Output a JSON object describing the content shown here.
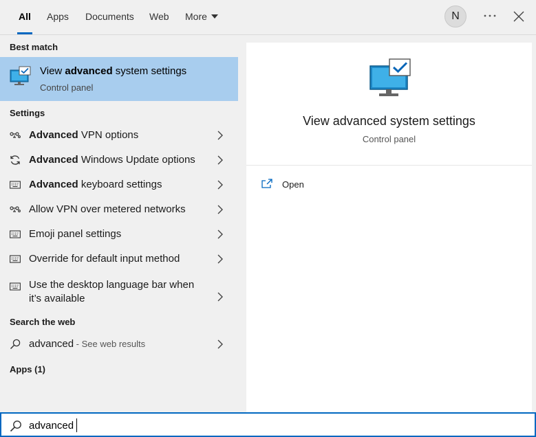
{
  "tabs": [
    {
      "label": "All"
    },
    {
      "label": "Apps"
    },
    {
      "label": "Documents"
    },
    {
      "label": "Web"
    },
    {
      "label": "More"
    }
  ],
  "user": {
    "initial": "N"
  },
  "sections": {
    "best_match": "Best match",
    "settings": "Settings",
    "search_web": "Search the web",
    "apps": "Apps (1)"
  },
  "best_match": {
    "title_pre": "View ",
    "title_bold": "advanced",
    "title_post": " system settings",
    "subtitle": "Control panel",
    "icon": "monitor-check-icon"
  },
  "settings_items": [
    {
      "bold": "Advanced",
      "rest": " VPN options",
      "icon": "vpn-icon"
    },
    {
      "bold": "Advanced",
      "rest": " Windows Update options",
      "icon": "sync-icon"
    },
    {
      "bold": "Advanced",
      "rest": " keyboard settings",
      "icon": "keyboard-icon"
    },
    {
      "bold": "",
      "rest": "Allow VPN over metered networks",
      "icon": "vpn-icon"
    },
    {
      "bold": "",
      "rest": "Emoji panel settings",
      "icon": "keyboard-icon"
    },
    {
      "bold": "",
      "rest": "Override for default input method",
      "icon": "keyboard-icon"
    },
    {
      "bold": "",
      "rest": "Use the desktop language bar when it’s available",
      "icon": "keyboard-icon"
    }
  ],
  "web_result": {
    "query": "advanced",
    "hint": " - See web results",
    "icon": "search-icon"
  },
  "preview": {
    "title": "View advanced system settings",
    "subtitle": "Control panel",
    "actions": [
      {
        "label": "Open",
        "icon": "open-icon"
      }
    ]
  },
  "search": {
    "value": "advanced",
    "icon": "search-icon"
  },
  "colors": {
    "accent": "#0067c0",
    "selection": "#a8cdee",
    "background": "#f0f0f0"
  }
}
